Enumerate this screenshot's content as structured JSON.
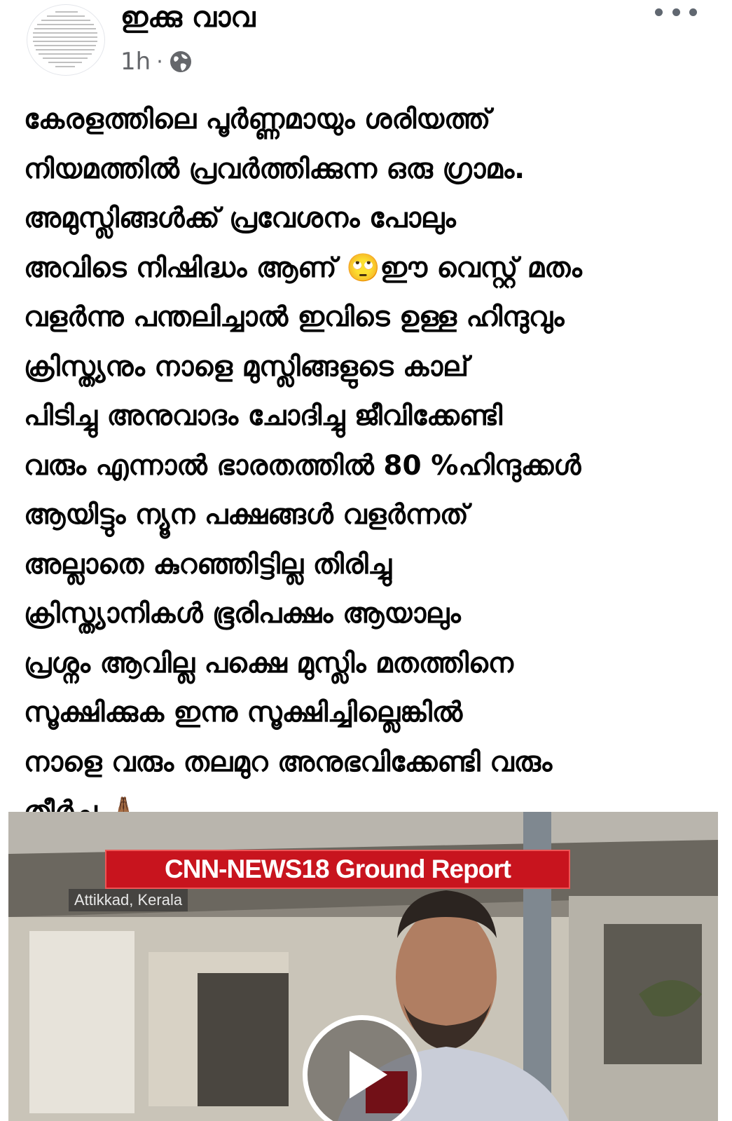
{
  "author": {
    "name": "ഇക്കു വാവ",
    "time": "1h",
    "separator": "·",
    "privacy_icon": "globe-icon",
    "avatar_icon": "avatar-text-image"
  },
  "more_icon": "more-dots-icon",
  "post": {
    "lines": [
      "കേരളത്തിലെ പൂർണ്ണമായും ശരിയത്ത്",
      "നിയമത്തിൽ പ്രവർത്തിക്കുന്ന ഒരു ഗ്രാമം.",
      "അമുസ്ലിങ്ങൾക്ക് പ്രവേശനം പോലും",
      "അവിടെ നിഷിദ്ധം ആണ് 🙄ഈ വെസ്റ്റ് മതം",
      "വളർന്നു പന്തലിച്ചാൽ ഇവിടെ ഉള്ള ഹിന്ദുവും",
      "ക്രിസ്ത്യനും നാളെ മുസ്ലിങ്ങളുടെ കാല്",
      "പിടിച്ചു അനുവാദം ചോദിച്ചു ജീവിക്കേണ്ടി",
      "വരും എന്നാൽ ഭാരതത്തിൽ 80 %ഹിന്ദുക്കൾ",
      "ആയിട്ടും ന്യൂന പക്ഷങ്ങൾ വളർന്നത്",
      "അല്ലാതെ കുറഞ്ഞിട്ടില്ല തിരിച്ചു",
      "ക്രിസ്ത്യാനികൾ ഭൂരിപക്ഷം ആയാലും",
      "പ്രശ്നം ആവില്ല പക്ഷെ മുസ്ലിം മതത്തിനെ",
      "സൂക്ഷിക്കുക ഇന്നു സൂക്ഷിച്ചില്ലെങ്കിൽ",
      "നാളെ വരും തലമുറ അനുഭവിക്കേണ്ടി വരും",
      "തീർച്ച 🙏🏾"
    ]
  },
  "video": {
    "banner": "CNN-NEWS18 Ground Report",
    "location": "Attikkad, Kerala",
    "play_icon": "play-icon"
  }
}
